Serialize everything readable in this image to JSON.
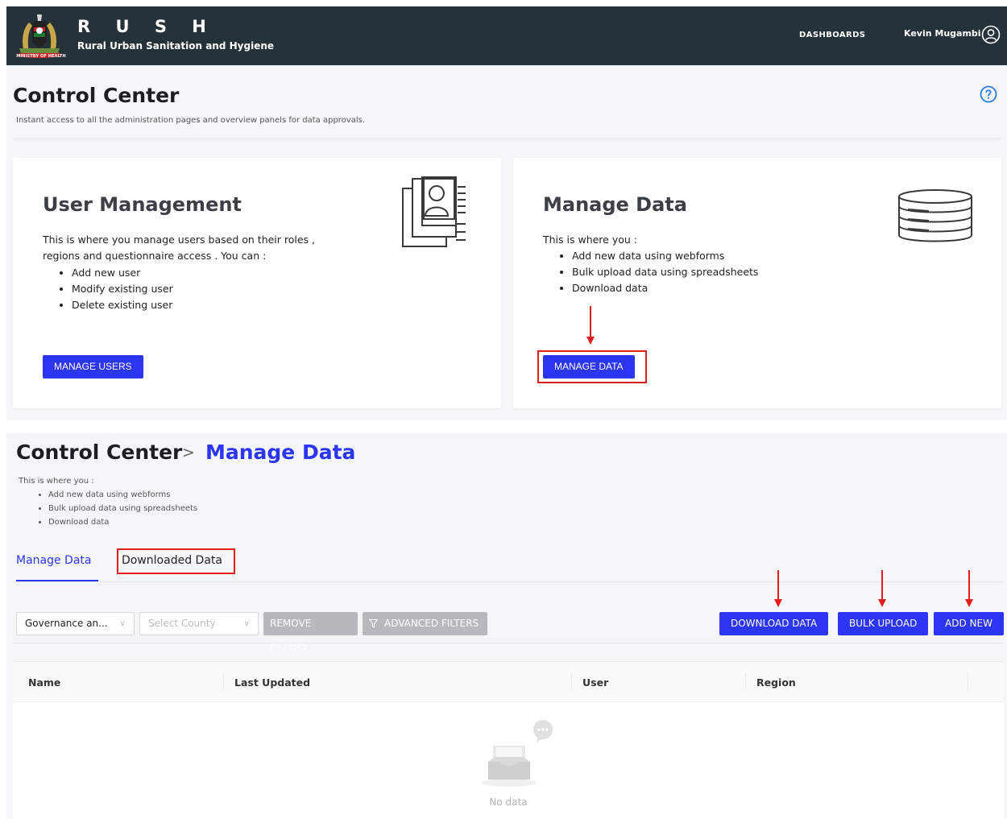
{
  "header": {
    "logo_caption": "MINISTRY OF HEALTH",
    "brand_title": "R U S H",
    "brand_subtitle": "Rural Urban Sanitation and Hygiene",
    "nav_dashboards": "DASHBOARDS",
    "user_name": "Kevin Mugambi",
    "user_icon": "user-circle-icon"
  },
  "control_center": {
    "title": "Control Center",
    "description": "Instant access to all the administration pages and overview panels for data approvals.",
    "help_icon": "question-circle-icon"
  },
  "cards": {
    "user_management": {
      "title": "User Management",
      "description": "This is where you manage users based on their roles , regions and questionnaire access . You can :",
      "items": [
        "Add new user",
        "Modify existing user",
        "Delete existing user"
      ],
      "button_label": "MANAGE USERS",
      "icon": "user-documents-icon"
    },
    "manage_data": {
      "title": "Manage Data",
      "description": "This is where you :",
      "items": [
        "Add new data using webforms",
        "Bulk upload data using spreadsheets",
        "Download data"
      ],
      "button_label": "MANAGE DATA",
      "icon": "database-icon"
    }
  },
  "manage_data_page": {
    "breadcrumb_root": "Control Center",
    "breadcrumb_separator": ">",
    "breadcrumb_current": "Manage Data",
    "description": "This is where you :",
    "items": [
      "Add new data using webforms",
      "Bulk upload data using spreadsheets",
      "Download data"
    ],
    "tabs": [
      {
        "label": "Manage Data",
        "active": true
      },
      {
        "label": "Downloaded Data",
        "active": false
      }
    ],
    "filters": {
      "form_select_value": "Governance an...",
      "county_select_placeholder": "Select County",
      "remove_filters_label": "REMOVE FILTERS",
      "advanced_filters_label": "ADVANCED FILTERS"
    },
    "actions": {
      "download_data_label": "DOWNLOAD DATA",
      "bulk_upload_label": "BULK UPLOAD",
      "add_new_label": "ADD NEW"
    },
    "table": {
      "columns": [
        "Name",
        "Last Updated",
        "User",
        "Region"
      ],
      "empty_text": "No data",
      "empty_icon": "empty-inbox-icon"
    }
  },
  "colors": {
    "topbar": "#253239",
    "primary": "#2b35f2",
    "disabled": "#b6b9bd",
    "highlight": "#e11d1d",
    "background": "#f5f6f8"
  }
}
